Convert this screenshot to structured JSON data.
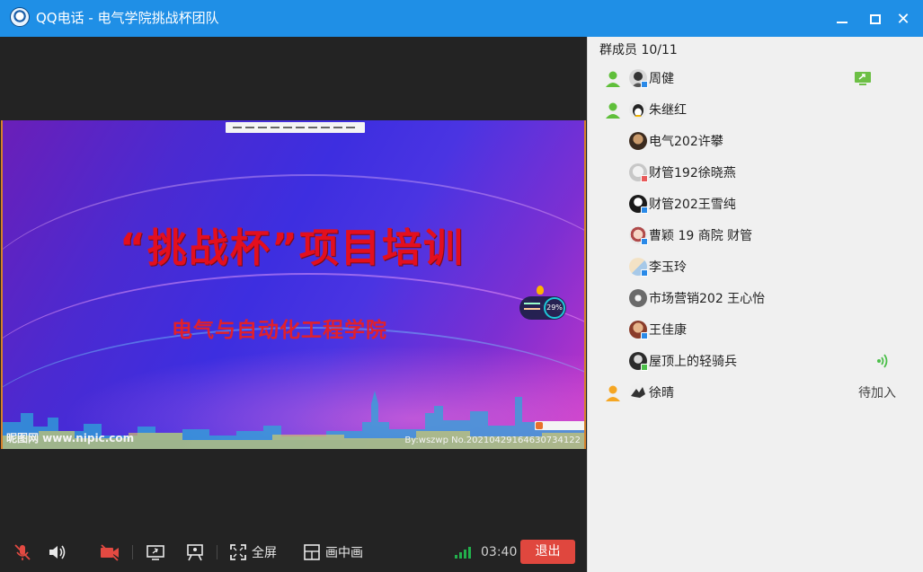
{
  "window": {
    "title": "QQ电话 - 电气学院挑战杯团队",
    "accent": "#1f8fe6"
  },
  "slide": {
    "title": "“挑战杯”项目培训",
    "subtitle": "电气与自动化工程学院",
    "watermark_left": "昵图网 www.nipic.com",
    "watermark_right": "By:wszwp No.20210429164630734122",
    "perf_percent": "29%"
  },
  "toolbar": {
    "fullscreen_label": "全屏",
    "pip_label": "画中画",
    "timer": "03:40",
    "exit_label": "退出",
    "exit_color": "#e0473e"
  },
  "members": {
    "header": "群成员 10/11",
    "items": [
      {
        "name": "周健",
        "role": "admin",
        "status": "",
        "right_icon": "screen-share-icon"
      },
      {
        "name": "朱继红",
        "role": "admin",
        "status": "",
        "right_icon": ""
      },
      {
        "name": "电气202许攀",
        "role": "",
        "status": "",
        "right_icon": ""
      },
      {
        "name": "财管192徐晓燕",
        "role": "",
        "status": "",
        "right_icon": ""
      },
      {
        "name": "财管202王雪纯",
        "role": "",
        "status": "",
        "right_icon": ""
      },
      {
        "name": "曹颖 19 商院 财管",
        "role": "",
        "status": "",
        "right_icon": ""
      },
      {
        "name": "李玉玲",
        "role": "",
        "status": "",
        "right_icon": ""
      },
      {
        "name": "市场营销202 王心怡",
        "role": "",
        "status": "",
        "right_icon": ""
      },
      {
        "name": "王佳康",
        "role": "",
        "status": "",
        "right_icon": ""
      },
      {
        "name": "屋顶上的轻骑兵",
        "role": "",
        "status": "",
        "right_icon": "speaking-icon"
      },
      {
        "name": "徐晴",
        "role": "owner",
        "status": "待加入",
        "right_icon": ""
      }
    ]
  }
}
